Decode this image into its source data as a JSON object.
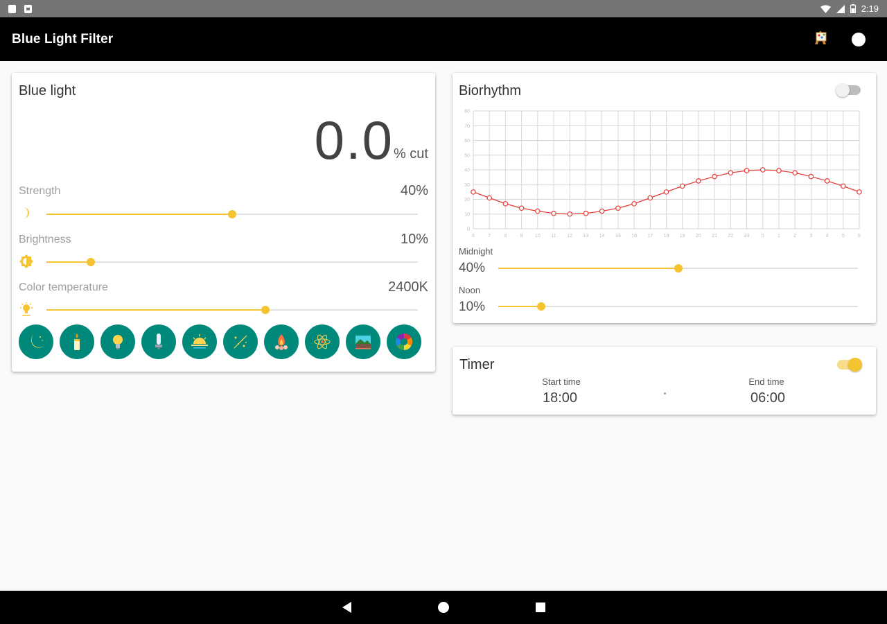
{
  "status_bar": {
    "time": "2:19",
    "battery_icon": "battery-icon",
    "wifi_icon": "wifi-icon",
    "signal_icon": "signal-icon"
  },
  "app_bar": {
    "title": "Blue Light Filter",
    "actions": [
      "paint-easel-icon",
      "record-circle-icon"
    ]
  },
  "blue_light": {
    "title": "Blue light",
    "cut_value": "0.0",
    "cut_unit": "% cut",
    "strength": {
      "label": "Strength",
      "value": "40%",
      "level": 0.5,
      "icon": "crescent-moon-icon"
    },
    "brightness": {
      "label": "Brightness",
      "value": "10%",
      "level": 0.12,
      "icon": "brightness-icon"
    },
    "color_temperature": {
      "label": "Color temperature",
      "value": "2400K",
      "level": 0.59,
      "icon": "light-bulb-icon"
    },
    "presets": [
      "moon-preset-icon",
      "candle-preset-icon",
      "bulb-preset-icon",
      "fluorescent-preset-icon",
      "sunrise-preset-icon",
      "stars-preset-icon",
      "campfire-preset-icon",
      "atom-preset-icon",
      "landscape-preset-icon",
      "color-wheel-preset-icon"
    ]
  },
  "biorhythm": {
    "title": "Biorhythm",
    "enabled": false,
    "midnight": {
      "label": "Midnight",
      "value": "40%",
      "level": 0.5
    },
    "noon": {
      "label": "Noon",
      "value": "10%",
      "level": 0.12
    }
  },
  "timer": {
    "title": "Timer",
    "enabled": true,
    "start": {
      "label": "Start time",
      "value": "18:00"
    },
    "end": {
      "label": "End time",
      "value": "06:00"
    }
  },
  "chart_data": {
    "type": "line",
    "x": [
      "6",
      "7",
      "8",
      "9",
      "10",
      "11",
      "12",
      "13",
      "14",
      "15",
      "16",
      "17",
      "18",
      "19",
      "20",
      "21",
      "22",
      "23",
      "0",
      "1",
      "2",
      "3",
      "4",
      "5",
      "6"
    ],
    "y_ticks": [
      0,
      10,
      20,
      30,
      40,
      50,
      60,
      70,
      80
    ],
    "ylim": [
      0,
      80
    ],
    "grid": true,
    "series": [
      {
        "values": [
          25,
          21,
          17,
          14,
          12,
          10.5,
          10,
          10.5,
          12,
          14,
          17,
          21,
          25,
          29,
          32.5,
          35.5,
          38,
          39.5,
          40,
          39.5,
          38,
          35.5,
          32.5,
          29,
          25
        ],
        "color": "#e53935"
      }
    ]
  },
  "colors": {
    "accent": "#f4c430",
    "preset_bg": "#00897b",
    "curve": "#e53935"
  }
}
